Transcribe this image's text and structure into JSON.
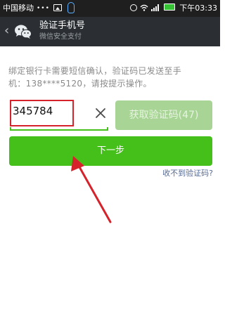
{
  "status_bar": {
    "carrier": "中国移动",
    "dots": "•••",
    "time": "下午03:33",
    "icons": [
      "image-icon",
      "qq-icon",
      "alarm-icon",
      "wifi-icon",
      "signal-icon",
      "battery-icon"
    ]
  },
  "header": {
    "back_glyph": "‹",
    "title": "验证手机号",
    "subtitle": "微信安全支付",
    "logo_icon": "wechat-logo-icon"
  },
  "main": {
    "description_line1": "绑定银行卡需要短信确认，验证码已发送至手",
    "description_line2": "机：138****5120，请按提示操作。",
    "code_input": {
      "value": "345784",
      "placeholder": ""
    },
    "clear_icon": "close-icon",
    "get_code_label": "获取验证码(47)",
    "next_label": "下一步",
    "no_code_link": "收不到验证码?"
  },
  "colors": {
    "accent": "#45c01a",
    "accent_disabled": "#a8d596",
    "header_bg": "#2b2f33",
    "status_bg": "#1f1f1f",
    "link": "#576b95",
    "annotation": "#d6222a"
  }
}
